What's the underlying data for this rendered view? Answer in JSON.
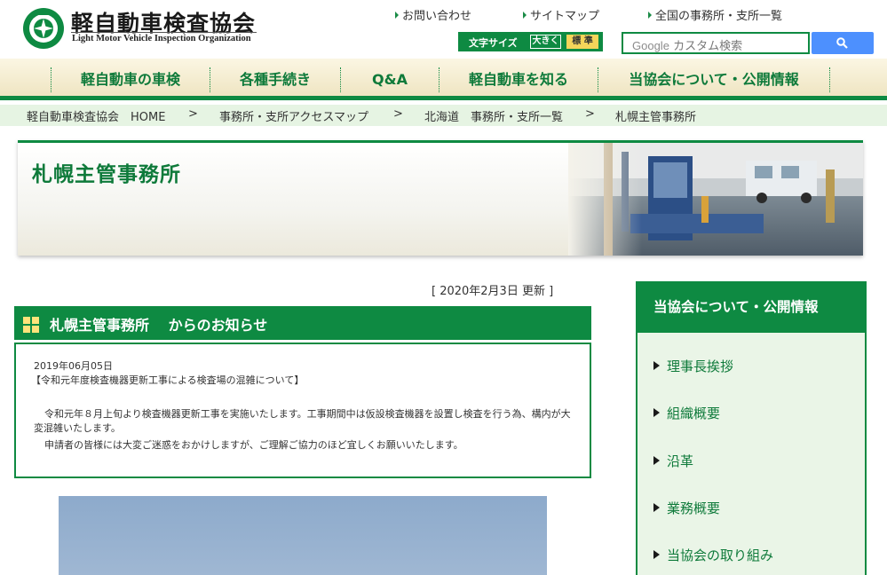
{
  "header": {
    "logo_title": "軽自動車検査協会",
    "logo_subtitle": "Light Motor Vehicle Inspection Organization",
    "top_links": [
      "お問い合わせ",
      "サイトマップ",
      "全国の事務所・支所一覧"
    ],
    "font_size": {
      "label": "文字サイズ",
      "large": "大きく",
      "standard": "標 準"
    },
    "search": {
      "brand": "Google",
      "placeholder": "カスタム検索"
    }
  },
  "nav": {
    "items": [
      "軽自動車の車検",
      "各種手続き",
      "Q&A",
      "軽自動車を知る",
      "当協会について・公開情報"
    ]
  },
  "breadcrumb": [
    "軽自動車検査協会　HOME",
    ">",
    "事務所・支所アクセスマップ",
    ">",
    "北海道　事務所・支所一覧",
    ">",
    "札幌主管事務所"
  ],
  "banner": {
    "title": "札幌主管事務所"
  },
  "updated": "[  2020年2月3日 更新  ]",
  "notice": {
    "heading": "札幌主管事務所　 からのお知らせ",
    "date": "2019年06月05日",
    "subject": "【令和元年度検査機器更新工事による検査場の混雑について】",
    "paragraph1": "令和元年８月上旬より検査機器更新工事を実施いたします。工事期間中は仮設検査機器を設置し検査を行う為、構内が大変混雑いたします。",
    "paragraph2": "申請者の皆様には大変ご迷惑をおかけしますが、ご理解ご協力のほど宜しくお願いいたします。"
  },
  "sidebar": {
    "heading": "当協会について・公開情報",
    "items": [
      "理事長挨拶",
      "組織概要",
      "沿革",
      "業務概要",
      "当協会の取り組み"
    ]
  },
  "colors": {
    "brand_green": "#0e8a42",
    "nav_bg": "#f3ead0",
    "crumb_bg": "#e6f4e3",
    "side_bg": "#eaf5e7",
    "search_blue": "#4d90fe"
  }
}
